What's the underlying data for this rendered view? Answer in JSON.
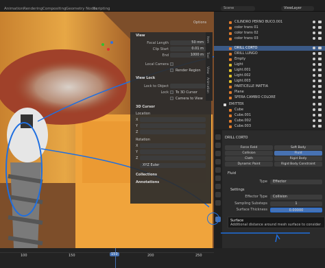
{
  "header": {
    "tabs": [
      "Animation",
      "Rendering",
      "Compositing",
      "Geometry Nodes",
      "Scripting"
    ],
    "outliner_search": "Scene",
    "view_layer": "ViewLayer"
  },
  "viewport_sidebar": {
    "options_label": "Options",
    "view_header": "View",
    "focal_length_label": "Focal Length",
    "focal_length_value": "50 mm",
    "clip_start_label": "Clip Start",
    "clip_start_value": "0.01 m",
    "clip_end_label": "End",
    "clip_end_value": "1000 m",
    "local_camera_label": "Local Camera",
    "render_region_label": "Render Region",
    "view_lock_header": "View Lock",
    "lock_to_object_label": "Lock to Object",
    "lock_label": "Lock",
    "to_3d_cursor_label": "To 3D Cursor",
    "camera_to_view_label": "Camera to View",
    "cursor_header": "3D Cursor",
    "location_label": "Location",
    "rotation_label": "Rotation",
    "axis": [
      "X",
      "Y",
      "Z"
    ],
    "rotation_mode": "XYZ Euler",
    "collections_header": "Collections",
    "annotations_header": "Annotations",
    "side_tabs": [
      "Item",
      "Tool",
      "View",
      "Animation"
    ]
  },
  "outliner": {
    "items": [
      "CILINDRO PERNO BUCO.001",
      "color trans 01",
      "color trans 02",
      "color trans 03",
      "DRILL CORTO",
      "DRILL LUNGO",
      "Empty",
      "Light",
      "Light.001",
      "Light.002",
      "Light.003",
      "PARTICELLE MATTIA",
      "Plane",
      "SFERA CAMBIO COLORE",
      "EMITTER",
      "Cube",
      "Cube.001",
      "Cube.002",
      "Cube.003"
    ]
  },
  "properties": {
    "object_name": "DRILL CORTO",
    "physics_buttons": [
      "Force Field",
      "Soft Body",
      "Collision",
      "Fluid",
      "Cloth",
      "Rigid Body",
      "Dynamic Paint",
      "Rigid Body Constraint"
    ],
    "fluid_header": "Fluid",
    "type_label": "Type",
    "type_value": "Effector",
    "settings_header": "Settings",
    "effector_type_label": "Effector Type",
    "effector_type_value": "Collision",
    "sampling_substeps_label": "Sampling Substeps",
    "sampling_substeps_value": "1",
    "surface_thickness_label": "Surface Thickness",
    "surface_thickness_value": "0.00000"
  },
  "tooltip": {
    "title": "Surface",
    "text": "Additional distance around mesh surface to consider as effector."
  },
  "timeline": {
    "ticks": [
      "100",
      "150",
      "200",
      "250"
    ],
    "current_frame": "150"
  }
}
